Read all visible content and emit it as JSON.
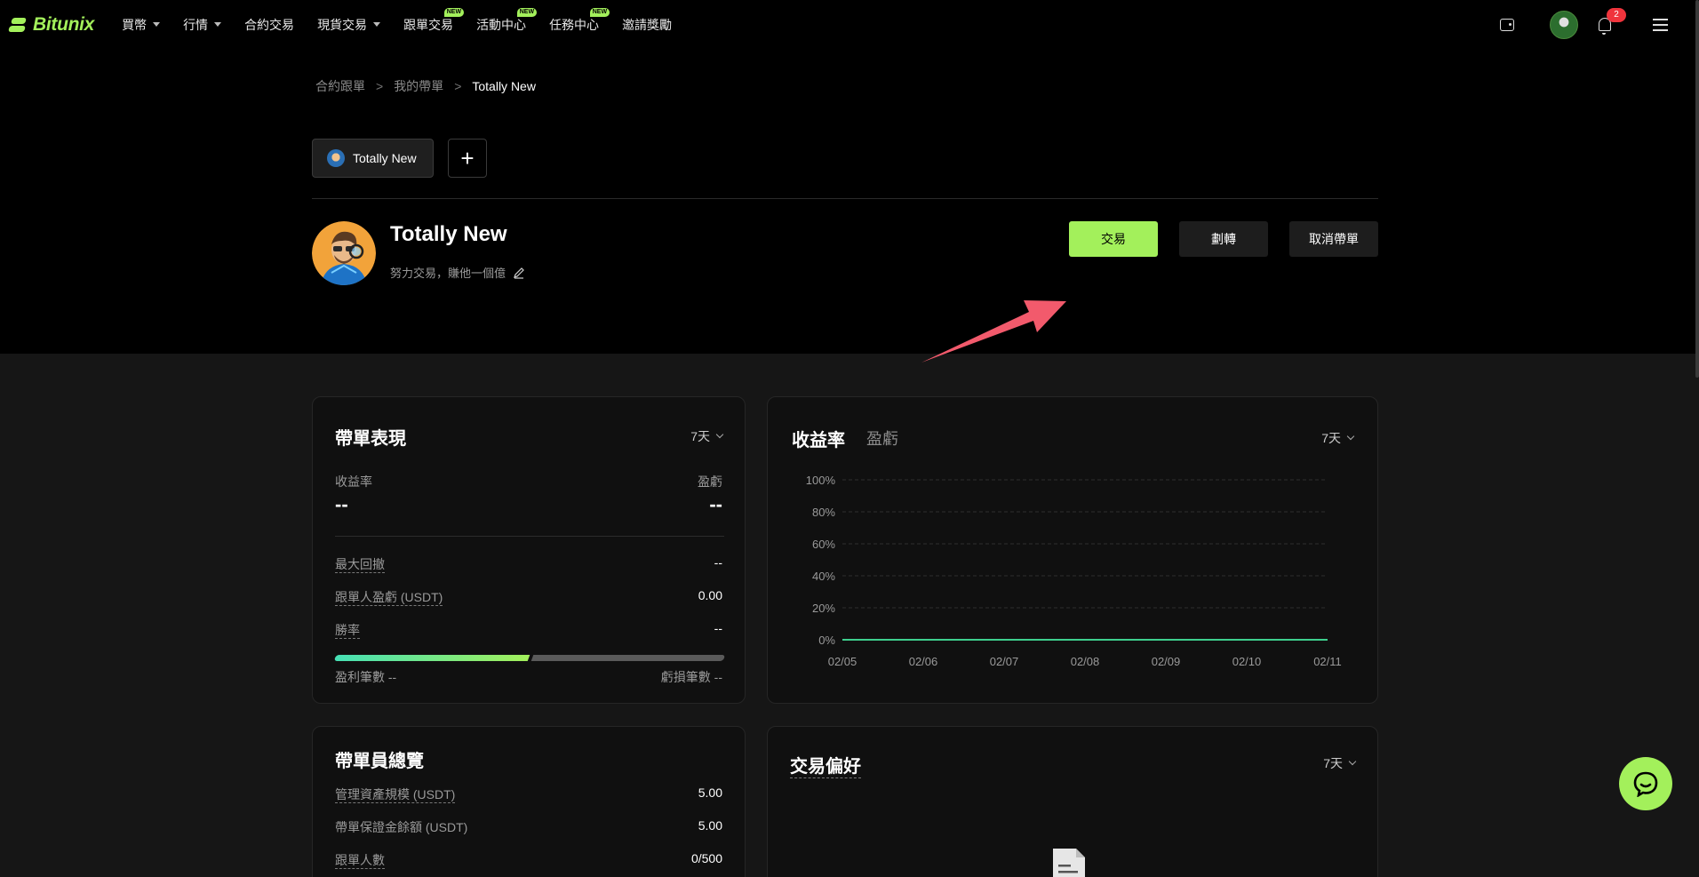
{
  "brand": {
    "name": "Bitunix",
    "accent": "#a3f05b"
  },
  "nav": {
    "items": [
      {
        "label": "買幣",
        "dropdown": true,
        "new": false
      },
      {
        "label": "行情",
        "dropdown": true,
        "new": false
      },
      {
        "label": "合約交易",
        "dropdown": false,
        "new": false
      },
      {
        "label": "現貨交易",
        "dropdown": true,
        "new": false
      },
      {
        "label": "跟單交易",
        "dropdown": false,
        "new": true
      },
      {
        "label": "活動中心",
        "dropdown": false,
        "new": true
      },
      {
        "label": "任務中心",
        "dropdown": false,
        "new": true
      },
      {
        "label": "邀請獎勵",
        "dropdown": false,
        "new": false
      }
    ],
    "new_badge": "NEW",
    "notification_count": "2",
    "icons": [
      "wallet-icon",
      "avatar",
      "bell-icon",
      "menu-icon"
    ]
  },
  "breadcrumb": {
    "items": [
      "合約跟單",
      "我的帶單"
    ],
    "current": "Totally New",
    "separator": ">"
  },
  "tabs": {
    "active_label": "Totally New",
    "add_label": "+"
  },
  "profile": {
    "name": "Totally New",
    "bio": "努力交易，賺他一個億"
  },
  "actions": {
    "trade": "交易",
    "transfer": "劃轉",
    "cancel": "取消帶單"
  },
  "performance": {
    "title": "帶單表現",
    "period": "7天",
    "yield_label": "收益率",
    "yield_value": "--",
    "pnl_label": "盈虧",
    "pnl_value": "--",
    "rows": [
      {
        "label": "最大回撤",
        "value": "--"
      },
      {
        "label": "跟單人盈虧 (USDT)",
        "value": "0.00"
      },
      {
        "label": "勝率",
        "value": "--"
      }
    ],
    "win_ratio": 0.5,
    "win_count_label": "盈利筆數",
    "win_count": "--",
    "loss_count_label": "虧損筆數",
    "loss_count": "--"
  },
  "yield_chart": {
    "tab_active": "收益率",
    "tab_inactive": "盈虧",
    "period": "7天"
  },
  "chart_data": {
    "type": "line",
    "categories": [
      "02/05",
      "02/06",
      "02/07",
      "02/08",
      "02/09",
      "02/10",
      "02/11"
    ],
    "yticks": [
      "0%",
      "20%",
      "40%",
      "60%",
      "80%",
      "100%"
    ],
    "ylim": [
      0,
      100
    ],
    "series": [
      {
        "values": [
          0,
          0,
          0,
          0,
          0,
          0,
          0
        ],
        "color": "#3ecf8e"
      }
    ],
    "grid": true
  },
  "overview": {
    "title": "帶單員總覽",
    "rows": [
      {
        "label": "管理資產規模 (USDT)",
        "value": "5.00"
      },
      {
        "label": "帶單保證金餘額 (USDT)",
        "value": "5.00"
      },
      {
        "label": "跟單人數",
        "value": "0/500"
      }
    ]
  },
  "preference": {
    "title": "交易偏好",
    "period": "7天"
  }
}
